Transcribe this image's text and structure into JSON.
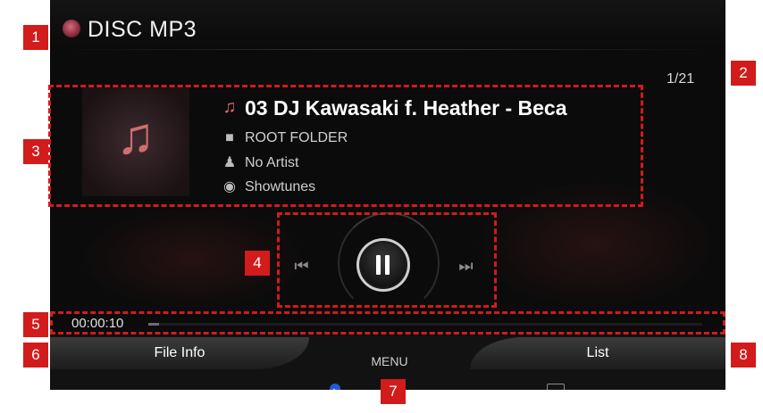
{
  "header": {
    "title": "DISC MP3"
  },
  "track_counter": "1/21",
  "track": {
    "title": "03 DJ Kawasaki f. Heather - Beca",
    "folder": "ROOT FOLDER",
    "artist": "No Artist",
    "genre": "Showtunes"
  },
  "controls": {
    "prev": "⏮",
    "next": "⏭"
  },
  "playback": {
    "elapsed": "00:00:10",
    "progress": 0.02
  },
  "bottom": {
    "left_button": "File Info",
    "menu": "MENU",
    "right_button": "List"
  },
  "annotations": [
    "1",
    "2",
    "3",
    "4",
    "5",
    "6",
    "7",
    "8"
  ],
  "colors": {
    "annotation": "#d21b1b",
    "accent": "#e26a6a",
    "bluetooth": "#1f5bd6"
  }
}
